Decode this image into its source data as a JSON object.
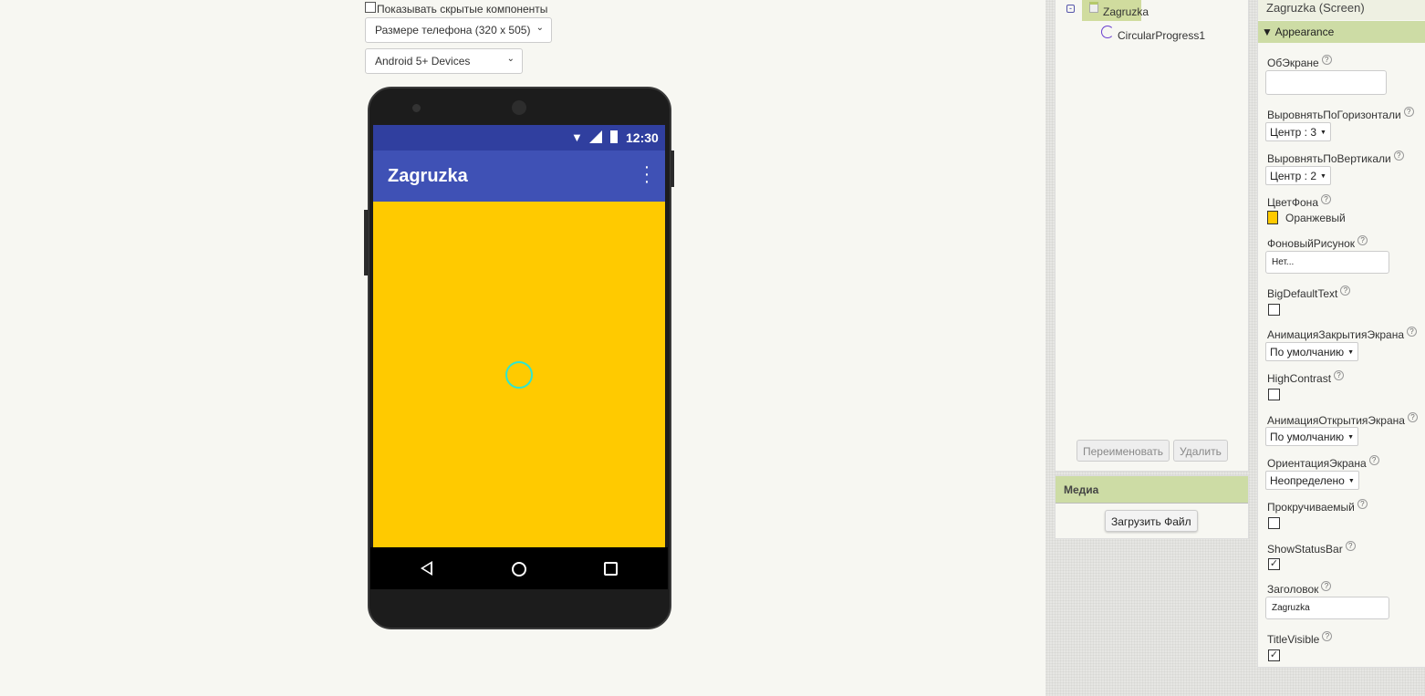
{
  "viewer": {
    "show_hidden_label": "Показывать скрытые компоненты",
    "show_hidden_checked": false,
    "size_select": "Размере телефона (320 x 505)",
    "device_select": "Android 5+ Devices"
  },
  "phone": {
    "time": "12:30",
    "app_title": "Zagruzka",
    "background_color": "#ffca00",
    "title_bar_color": "#3f51b5",
    "status_bar_color": "#303f9f",
    "progress_color": "#2ee6d0"
  },
  "tree": {
    "root": "Zagruzka",
    "children": [
      "CircularProgress1"
    ],
    "rename_button": "Переименовать",
    "delete_button": "Удалить"
  },
  "media": {
    "title": "Медиа",
    "upload_button": "Загрузить Файл"
  },
  "properties": {
    "header": "Zagruzka (Screen)",
    "section": "Appearance",
    "about_label": "ОбЭкране",
    "about_value": "",
    "align_h_label": "ВыровнятьПоГоризонтали",
    "align_h_value": "Центр : 3",
    "align_v_label": "ВыровнятьПоВертикали",
    "align_v_value": "Центр : 2",
    "bg_color_label": "ЦветФона",
    "bg_color_value": "Оранжевый",
    "bg_image_label": "ФоновыйРисунок",
    "bg_image_value": "Нет...",
    "big_text_label": "BigDefaultText",
    "big_text_checked": false,
    "close_anim_label": "АнимацияЗакрытияЭкрана",
    "close_anim_value": "По умолчанию",
    "high_contrast_label": "HighContrast",
    "high_contrast_checked": false,
    "open_anim_label": "АнимацияОткрытияЭкрана",
    "open_anim_value": "По умолчанию",
    "orientation_label": "ОриентацияЭкрана",
    "orientation_value": "Неопределено",
    "scrollable_label": "Прокручиваемый",
    "scrollable_checked": false,
    "status_bar_label": "ShowStatusBar",
    "status_bar_checked": true,
    "title_label": "Заголовок",
    "title_value": "Zagruzka",
    "title_visible_label": "TitleVisible",
    "title_visible_checked": true
  }
}
